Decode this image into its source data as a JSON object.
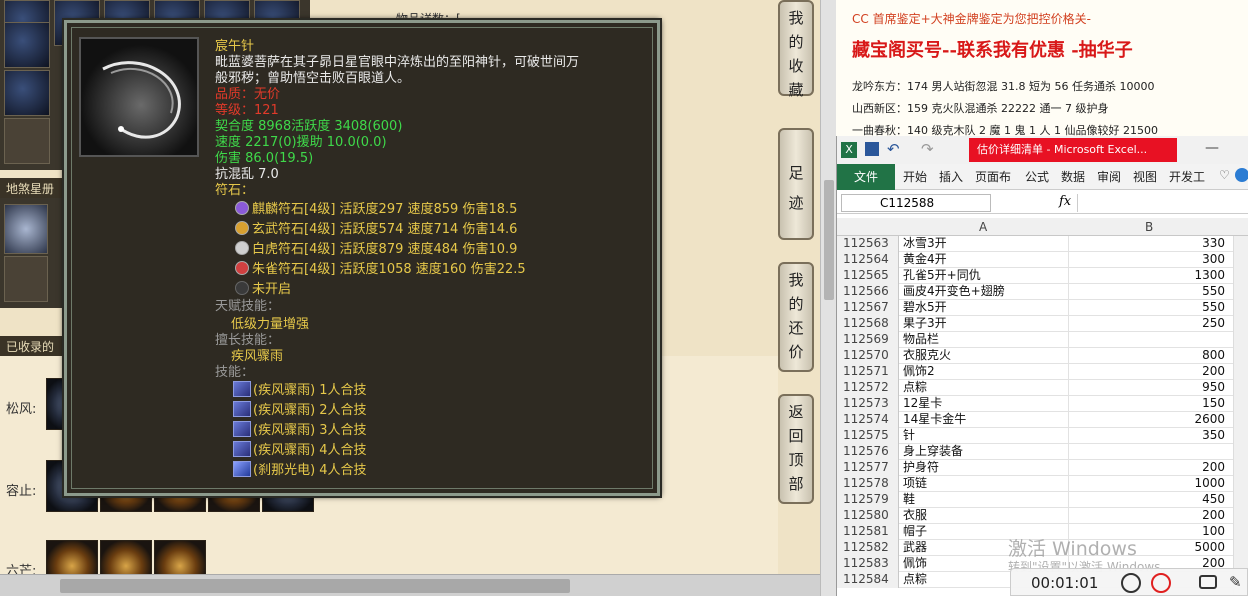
{
  "game": {
    "top_label_partial": "物品详数：[",
    "left_panel_title": "地煞星册",
    "collected_title": "已收录的",
    "row_labels": [
      "松风:",
      "容止:",
      "六芒:"
    ],
    "nav_buttons": [
      {
        "label": "我的收藏"
      },
      {
        "label": "足迹"
      },
      {
        "label": "我的还价"
      },
      {
        "label": "返回顶部"
      }
    ]
  },
  "tooltip": {
    "item_name": "宸午针",
    "description_1": "毗蓝婆菩萨在其子昴日星官眼中淬炼出的至阳神针，可破世间万",
    "description_2": "般邪秽；曾助悟空击败百眼道人。",
    "quality": "品质：无价",
    "level": "等级：121",
    "attrs": [
      "契合度     8968活跃度   3408(600)",
      "速度     2217(0)援助     10.0(0.0)",
      "伤害     86.0(19.5)"
    ],
    "resist": "抗混乱 7.0",
    "runes_title": "符石：",
    "runes": [
      {
        "text": "麒麟符石[4级] 活跃度297 速度859 伤害18.5",
        "color": "#8a5ad8"
      },
      {
        "text": "玄武符石[4级] 活跃度574 速度714 伤害14.6",
        "color": "#d8a030"
      },
      {
        "text": "白虎符石[4级] 活跃度879 速度484 伤害10.9",
        "color": "#cfcfcf"
      },
      {
        "text": "朱雀符石[4级] 活跃度1058 速度160 伤害22.5",
        "color": "#d04040"
      }
    ],
    "rune_empty": "未开启",
    "talent_title": "天赋技能：",
    "talent": "低级力量增强",
    "special_title": "擅长技能：",
    "special": "疾风骤雨",
    "skills_title": "技能：",
    "skills": [
      "(疾风骤雨) 1人合技",
      "(疾风骤雨) 2人合技",
      "(疾风骤雨) 3人合技",
      "(疾风骤雨) 4人合技",
      "(刹那光电) 4人合技"
    ]
  },
  "right_page": {
    "line1": "CC 首席鉴定+大神金牌鉴定为您把控价格关-",
    "headline": "藏宝阁买号--联系我有优惠 -抽华子",
    "line2": "龙吟东方：174 男人站街忽混 31.8 短为 56 任务通杀 10000",
    "line3": "山西新区：159 克火队混通杀 22222 通一 7 级护身",
    "line4": "一曲春秋：140 级克木队 2 魔 1 鬼 1 人 1 仙品像较好 21500"
  },
  "excel": {
    "window_title": "估价详细清单 - Microsoft Excel...",
    "ribbon_tabs": [
      "文件",
      "开始",
      "插入",
      "页面布",
      "公式",
      "数据",
      "审阅",
      "视图",
      "开发工"
    ],
    "name_box": "C112588",
    "fx": "fx",
    "col_a": "A",
    "col_b": "B",
    "rows": [
      {
        "n": "112563",
        "a": "冰雪3开",
        "b": "330"
      },
      {
        "n": "112564",
        "a": "黄金4开",
        "b": "300"
      },
      {
        "n": "112565",
        "a": "孔雀5开+同仇",
        "b": "1300"
      },
      {
        "n": "112566",
        "a": "画皮4开变色+翅膀",
        "b": "550"
      },
      {
        "n": "112567",
        "a": "碧水5开",
        "b": "550"
      },
      {
        "n": "112568",
        "a": "果子3开",
        "b": "250"
      },
      {
        "n": "112569",
        "a": "物品栏",
        "b": ""
      },
      {
        "n": "112570",
        "a": "衣服克火",
        "b": "800"
      },
      {
        "n": "112571",
        "a": "佩饰2",
        "b": "200"
      },
      {
        "n": "112572",
        "a": "点粽",
        "b": "950"
      },
      {
        "n": "112573",
        "a": "12星卡",
        "b": "150"
      },
      {
        "n": "112574",
        "a": "14星卡金牛",
        "b": "2600"
      },
      {
        "n": "112575",
        "a": "针",
        "b": "350"
      },
      {
        "n": "112576",
        "a": "身上穿装备",
        "b": ""
      },
      {
        "n": "112577",
        "a": "护身符",
        "b": "200"
      },
      {
        "n": "112578",
        "a": "项链",
        "b": "1000"
      },
      {
        "n": "112579",
        "a": "鞋",
        "b": "450"
      },
      {
        "n": "112580",
        "a": "衣服",
        "b": "200"
      },
      {
        "n": "112581",
        "a": "帽子",
        "b": "100"
      },
      {
        "n": "112582",
        "a": "武器",
        "b": "5000"
      },
      {
        "n": "112583",
        "a": "佩饰",
        "b": "200"
      },
      {
        "n": "112584",
        "a": "点粽",
        "b": ""
      }
    ]
  },
  "overlay": {
    "watermark": "激活 Windows",
    "watermark_sub": "转到\"设置\"以激活 Windows。",
    "rec_time": "00:01:01"
  }
}
